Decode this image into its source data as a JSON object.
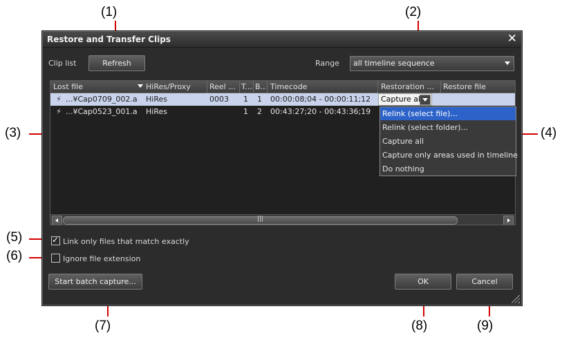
{
  "callouts": [
    "(1)",
    "(2)",
    "(3)",
    "(4)",
    "(5)",
    "(6)",
    "(7)",
    "(8)",
    "(9)"
  ],
  "dialog": {
    "title": "Restore and Transfer Clips",
    "close_glyph": "✕",
    "clip_list_label": "Clip list",
    "refresh_label": "Refresh",
    "range_label": "Range",
    "range_value": "all timeline sequence",
    "columns": [
      "Lost file",
      "HiRes/Proxy",
      "Reel ...",
      "T...",
      "B...",
      "Timecode",
      "Restoration ...",
      "Restore file"
    ],
    "rows": [
      {
        "lost_file": "...¥Cap0709_002.a",
        "hires": "HiRes",
        "reel": "0003",
        "t": "1",
        "b": "1",
        "timecode": "00:00:08;04 - 00:00:11;12",
        "restoration": "Capture all",
        "restore_file": ""
      },
      {
        "lost_file": "...¥Cap0523_001.a",
        "hires": "HiRes",
        "reel": "",
        "t": "1",
        "b": "2",
        "timecode": "00:43:27;20 - 00:43:36;19",
        "restoration": "",
        "restore_file": ""
      }
    ],
    "restoration_options": [
      "Relink (select file)...",
      "Relink (select folder)...",
      "Capture all",
      "Capture only areas used in timeline",
      "Do nothing"
    ],
    "scroll_thumb_glyph": "|||",
    "link_exact_label": "Link only files that match exactly",
    "link_exact_checked": true,
    "ignore_ext_label": "Ignore file extension",
    "ignore_ext_checked": false,
    "batch_capture_label": "Start batch capture...",
    "ok_label": "OK",
    "cancel_label": "Cancel"
  },
  "colors": {
    "accent": "#d40000",
    "selection": "#2d63c8",
    "row_highlight": "#c9d3ec"
  }
}
